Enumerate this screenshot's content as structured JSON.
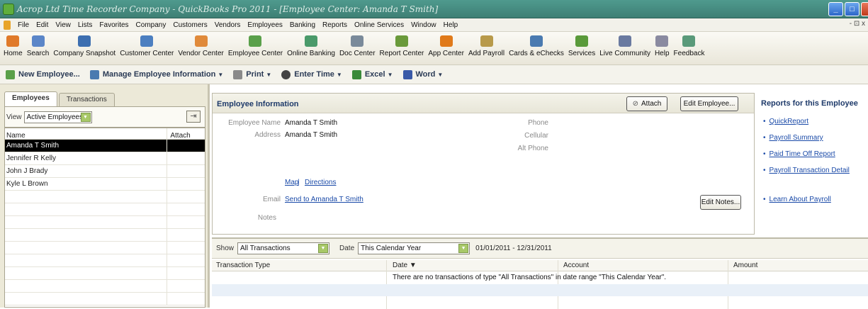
{
  "window": {
    "title": "Acrop Ltd Time Recorder Company - QuickBooks Pro 2011 - [Employee Center: Amanda T Smith]",
    "controls": {
      "minimize": "_",
      "maximize": "□",
      "close": "X"
    }
  },
  "menubar": {
    "items": [
      "File",
      "Edit",
      "View",
      "Lists",
      "Favorites",
      "Company",
      "Customers",
      "Vendors",
      "Employees",
      "Banking",
      "Reports",
      "Online Services",
      "Window",
      "Help"
    ],
    "mdi_controls": "- ⊡ x"
  },
  "iconbar": {
    "items": [
      {
        "label": "Home",
        "color": "#e07a2a"
      },
      {
        "label": "Search",
        "color": "#5b86c8"
      },
      {
        "label": "Company Snapshot",
        "color": "#3d6fb0"
      },
      {
        "label": "Customer Center",
        "color": "#4c7fc0"
      },
      {
        "label": "Vendor Center",
        "color": "#e08a3a"
      },
      {
        "label": "Employee Center",
        "color": "#5aa04a"
      },
      {
        "label": "Online Banking",
        "color": "#4a9a6a"
      },
      {
        "label": "Doc Center",
        "color": "#7a8a9a"
      },
      {
        "label": "Report Center",
        "color": "#6a9a3a"
      },
      {
        "label": "App Center",
        "color": "#e07a1a"
      },
      {
        "label": "Add Payroll",
        "color": "#b89a4a"
      },
      {
        "label": "Cards & eChecks",
        "color": "#4a7ab0"
      },
      {
        "label": "Services",
        "color": "#5a9a3a"
      },
      {
        "label": "Live Community",
        "color": "#6a7aa0"
      },
      {
        "label": "Help",
        "color": "#8a8aa0"
      },
      {
        "label": "Feedback",
        "color": "#5a9a7a"
      }
    ]
  },
  "toolbar": {
    "new_employee": "New Employee...",
    "manage_info": "Manage Employee Information",
    "print": "Print",
    "enter_time": "Enter Time",
    "excel": "Excel",
    "word": "Word"
  },
  "leftpane": {
    "tabs": [
      "Employees",
      "Transactions"
    ],
    "view_label": "View",
    "view_value": "Active Employees",
    "columns": {
      "name": "Name",
      "attach": "Attach"
    },
    "employees": [
      "Amanda T Smith",
      "Jennifer R Kelly",
      "John J Brady",
      "Kyle L Brown"
    ]
  },
  "info": {
    "title": "Employee Information",
    "attach_label": "Attach",
    "edit_employee_label": "Edit Employee...",
    "employee_name_label": "Employee Name",
    "employee_name": "Amanda T Smith",
    "address_label": "Address",
    "address": "Amanda T Smith",
    "phone_label": "Phone",
    "cellular_label": "Cellular",
    "alt_phone_label": "Alt Phone",
    "map_link": "Map",
    "sep": "|",
    "directions_link": "Directions",
    "email_label": "Email",
    "email_link": "Send to Amanda T Smith",
    "notes_label": "Notes",
    "edit_notes_label": "Edit Notes..."
  },
  "reports": {
    "title": "Reports for this Employee",
    "items": [
      "QuickReport",
      "Payroll Summary",
      "Paid Time Off Report",
      "Payroll Transaction Detail",
      "Learn About Payroll"
    ]
  },
  "transactions": {
    "show_label": "Show",
    "show_value": "All Transactions",
    "date_label": "Date",
    "date_value": "This Calendar Year",
    "date_range": "01/01/2011 - 12/31/2011",
    "columns": {
      "type": "Transaction Type",
      "date": "Date ▼",
      "account": "Account",
      "amount": "Amount"
    },
    "empty_message": "There are no transactions of type \"All Transactions\" in date range \"This Calendar Year\"."
  }
}
